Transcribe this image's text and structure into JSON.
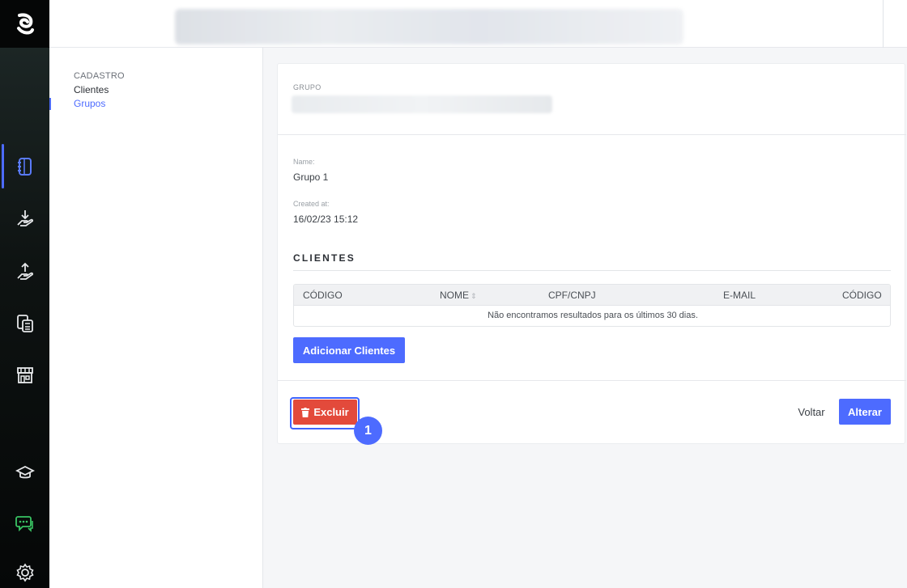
{
  "rail": {
    "icons": [
      "app-logo-icon",
      "document-icon",
      "download-hand-icon",
      "upload-hand-icon",
      "calculator-icon",
      "store-icon",
      "graduation-cap-icon",
      "chat-icon",
      "gear-icon"
    ]
  },
  "sidenav": {
    "section": "CADASTRO",
    "items": [
      {
        "label": "Clientes",
        "active": false
      },
      {
        "label": "Grupos",
        "active": true
      }
    ]
  },
  "card": {
    "group_label": "GRUPO",
    "fields": [
      {
        "label": "Name:",
        "value": "Grupo 1"
      },
      {
        "label": "Created at:",
        "value": "16/02/23 15:12"
      }
    ],
    "section_title": "CLIENTES",
    "table": {
      "columns": [
        "CÓDIGO",
        "NOME",
        "CPF/CNPJ",
        "E-MAIL",
        "CÓDIGO"
      ],
      "sort_glyph": "⇕",
      "empty_message": "Não encontramos resultados para os últimos 30 dias."
    },
    "add_button": "Adicionar Clientes",
    "delete_button": "Excluir",
    "back_button": "Voltar",
    "edit_button": "Alterar"
  },
  "badge": "1",
  "colors": {
    "accent": "#4d6bff",
    "danger": "#e34a3b",
    "rail_bg": "#0e1312",
    "chat_icon": "#39c463"
  }
}
